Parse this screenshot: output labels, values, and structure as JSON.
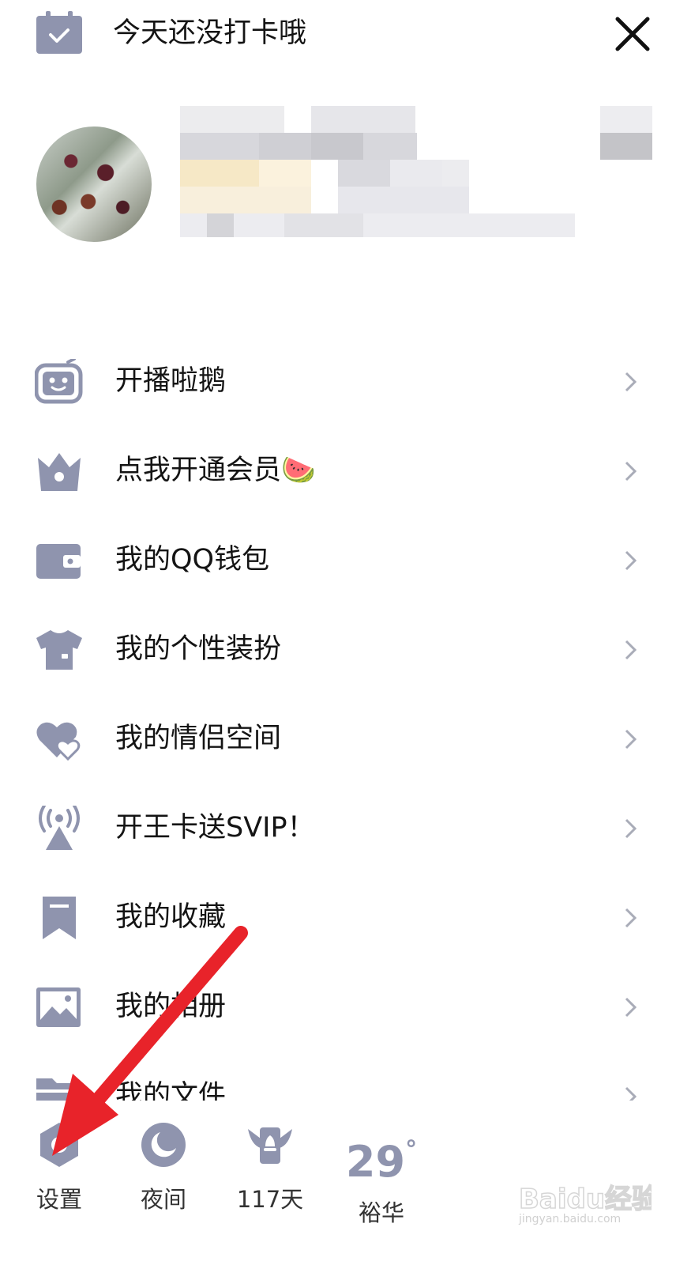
{
  "topbar": {
    "checkin_text": "今天还没打卡哦"
  },
  "menu": [
    {
      "label": "开播啦鹅",
      "icon": "tv-robot-icon"
    },
    {
      "label": "点我开通会员",
      "icon": "crown-icon",
      "emoji": "🍉"
    },
    {
      "label": "我的QQ钱包",
      "icon": "wallet-icon"
    },
    {
      "label": "我的个性装扮",
      "icon": "tshirt-icon"
    },
    {
      "label": "我的情侣空间",
      "icon": "hearts-icon"
    },
    {
      "label": "开王卡送SVIP！",
      "icon": "signal-tower-icon"
    },
    {
      "label": "我的收藏",
      "icon": "bookmark-icon"
    },
    {
      "label": "我的相册",
      "icon": "photo-icon"
    },
    {
      "label": "我的文件",
      "icon": "folder-icon"
    }
  ],
  "bottom": {
    "settings_label": "设置",
    "night_label": "夜间",
    "days_label": "117天",
    "weather_temp": "29",
    "weather_unit": "°",
    "weather_location": "裕华"
  },
  "watermark": {
    "text": "Baidu经验",
    "url": "jingyan.baidu.com"
  },
  "colors": {
    "icon": "#8f94ae",
    "text": "#141414",
    "arrow_annotation": "#e8232a"
  }
}
